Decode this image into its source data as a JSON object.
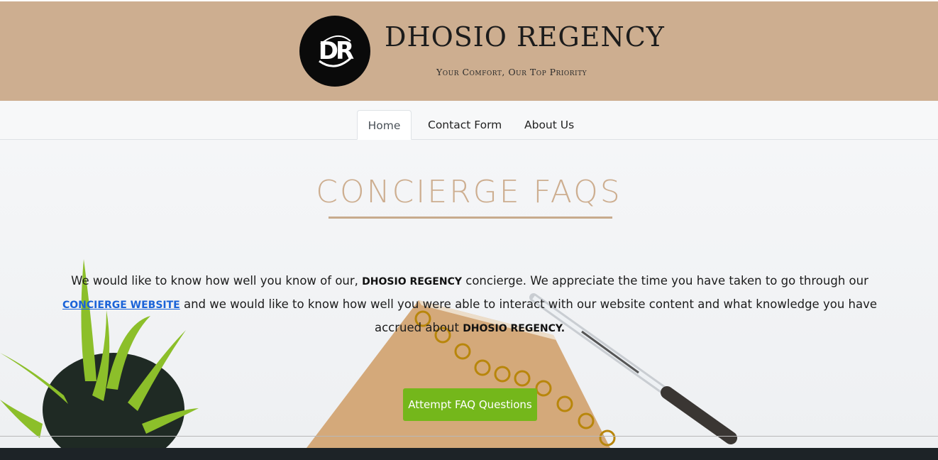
{
  "header": {
    "logo_text": "DR",
    "brand_name": "DHOSIO REGENCY",
    "tagline": "Your Comfort, Our Top Priority",
    "background_color": "#cdae90"
  },
  "nav": {
    "tabs": [
      {
        "label": "Home",
        "active": true
      },
      {
        "label": "Contact Form",
        "active": false
      },
      {
        "label": "About Us",
        "active": false
      }
    ]
  },
  "main": {
    "title": "CONCIERGE FAQS",
    "title_color": "#cdae90",
    "paragraph": {
      "part1": "We would like to know how well you know of our, ",
      "brand1": "DHOSIO REGENCY",
      "part2": " concierge. We appreciate the time you have taken to go through our ",
      "link_text": "CONCIERGE WEBSITE",
      "part3": " and we would like to know how well you were able to interact with our website content and what knowledge you have accrued about ",
      "brand2": "DHOSIO REGENCY."
    },
    "cta_label": "Attempt FAQ Questions",
    "cta_color": "#74b71b",
    "link_color": "#1a63d8"
  },
  "background_icons": [
    "plant-icon",
    "notebook-icon",
    "pen-icon"
  ]
}
